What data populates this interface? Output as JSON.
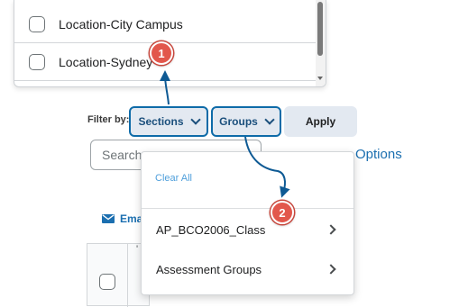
{
  "sections_list": {
    "options": [
      {
        "label": "Location-City Campus"
      },
      {
        "label": "Location-Sydney"
      }
    ]
  },
  "filter_bar": {
    "label": "Filter by:",
    "sections_label": "Sections",
    "groups_label": "Groups",
    "apply_label": "Apply"
  },
  "search": {
    "placeholder": "Search"
  },
  "options_link": "Options",
  "email_label": "Ema",
  "background_fragments": {
    "header_text": "'",
    "row_text": "o"
  },
  "groups_menu": {
    "clear_all": "Clear All",
    "items": [
      {
        "label": "AP_BCO2006_Class"
      },
      {
        "label": "Assessment Groups"
      }
    ]
  },
  "callouts": [
    "1",
    "2"
  ],
  "colors": {
    "accent_blue": "#1b6fb0",
    "highlight_border": "#0e6ba8",
    "callout_red": "#e2574c",
    "button_bg": "#e3e9f1"
  }
}
